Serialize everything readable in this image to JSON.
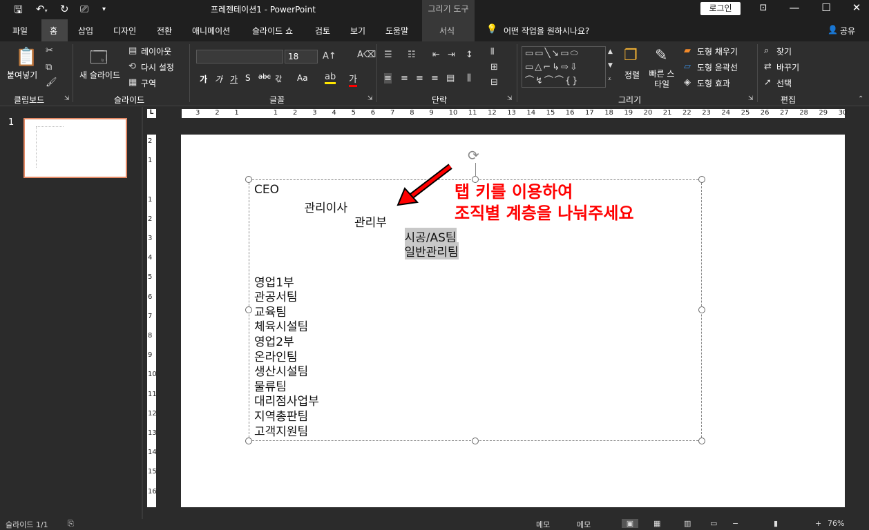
{
  "window": {
    "title": "프레젠테이션1  -  PowerPoint",
    "context_title": "그리기 도구",
    "login": "로그인"
  },
  "tabs": {
    "file": "파일",
    "home": "홈",
    "insert": "삽입",
    "design": "디자인",
    "transitions": "전환",
    "animations": "애니메이션",
    "slideshow": "슬라이드 쇼",
    "review": "검토",
    "view": "보기",
    "help": "도움말",
    "format": "서식",
    "tell_me": "어떤 작업을 원하시나요?",
    "share": "공유"
  },
  "ribbon": {
    "clipboard": {
      "paste": "붙여넣기",
      "label": "클립보드"
    },
    "slides": {
      "new_slide": "새 슬라이드",
      "layout": "레이아웃",
      "reset": "다시 설정",
      "section": "구역",
      "label": "슬라이드"
    },
    "font": {
      "name": "",
      "size": "18",
      "label": "글꼴",
      "bold": "가",
      "italic": "가",
      "underline": "가",
      "shadow": "S",
      "strike": "abc",
      "spacing": "갃",
      "case": "Aa"
    },
    "paragraph": {
      "label": "단락"
    },
    "drawing": {
      "arrange": "정렬",
      "quick_styles": "빠른 스타일",
      "fill": "도형 채우기",
      "outline": "도형 윤곽선",
      "effects": "도형 효과",
      "label": "그리기"
    },
    "editing": {
      "find": "찾기",
      "replace": "바꾸기",
      "select": "선택",
      "label": "편집"
    }
  },
  "thumbnail": {
    "number": "1"
  },
  "ruler": {
    "h_ticks": [
      "3",
      "2",
      "1",
      "",
      "1",
      "2",
      "3",
      "4",
      "5",
      "6",
      "7",
      "8",
      "9",
      "10",
      "11",
      "12",
      "13",
      "14",
      "15",
      "16",
      "17",
      "18",
      "19",
      "20",
      "21",
      "22",
      "23",
      "24",
      "25",
      "26",
      "27",
      "28",
      "29",
      "30"
    ],
    "v_ticks": [
      "2",
      "1",
      "",
      "1",
      "2",
      "3",
      "4",
      "5",
      "6",
      "7",
      "8",
      "9",
      "10",
      "11",
      "12",
      "13",
      "14",
      "15",
      "16"
    ]
  },
  "slide": {
    "lines": [
      {
        "text": "CEO",
        "indent": 0
      },
      {
        "text": "관리이사",
        "indent": 1
      },
      {
        "text": "관리부",
        "indent": 2
      },
      {
        "text": "시공/AS팀",
        "indent": 3,
        "highlight": true
      },
      {
        "text": "일반관리팀",
        "indent": 3,
        "highlight": true
      },
      {
        "text": "영업1부",
        "indent": 0
      },
      {
        "text": "관공서팀",
        "indent": 0
      },
      {
        "text": "교육팀",
        "indent": 0
      },
      {
        "text": "체육시설팀",
        "indent": 0
      },
      {
        "text": "영업2부",
        "indent": 0
      },
      {
        "text": "온라인팀",
        "indent": 0
      },
      {
        "text": "생산시설팀",
        "indent": 0
      },
      {
        "text": "물류팀",
        "indent": 0
      },
      {
        "text": "대리점사업부",
        "indent": 0
      },
      {
        "text": "지역총판팀",
        "indent": 0
      },
      {
        "text": "고객지원팀",
        "indent": 0
      }
    ],
    "callout_line1": "탭 키를 이용하여",
    "callout_line2": "조직별 계층을 나눠주세요",
    "callout_color": "#ff0000"
  },
  "status": {
    "slide": "슬라이드 1/1",
    "notes": "메모",
    "comments": "메모",
    "zoom": "76%"
  }
}
